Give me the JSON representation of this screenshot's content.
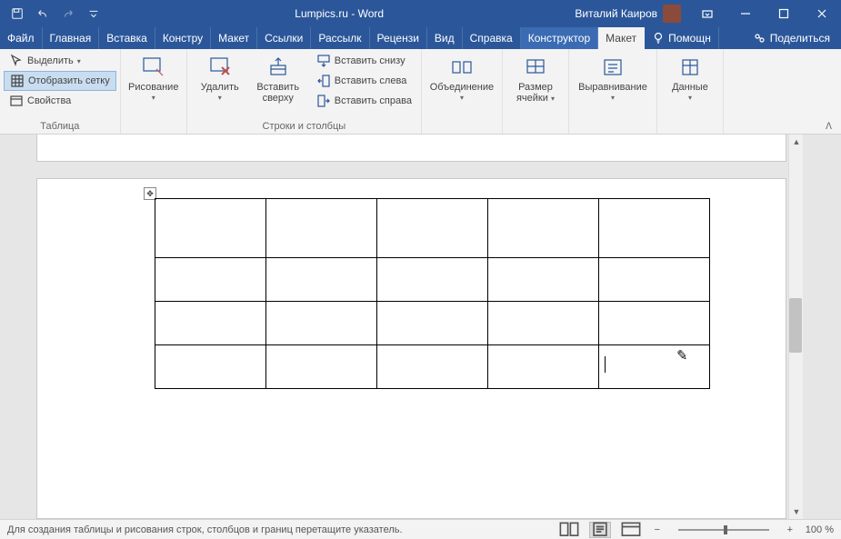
{
  "title": "Lumpics.ru  -  Word",
  "account_name": "Виталий Каиров",
  "tabs": {
    "file": "Файл",
    "home": "Главная",
    "insert": "Вставка",
    "design": "Констру",
    "layout": "Макет",
    "references": "Ссылки",
    "mailings": "Рассылк",
    "review": "Рецензи",
    "view": "Вид",
    "help": "Справка",
    "tbl_design": "Конструктор",
    "tbl_layout": "Макет",
    "tell_me": "Помощн",
    "share": "Поделиться"
  },
  "ribbon": {
    "table_group": "Таблица",
    "select": "Выделить",
    "view_gridlines": "Отобразить сетку",
    "properties": "Свойства",
    "draw": "Рисование",
    "delete": "Удалить",
    "insert_above": "Вставить сверху",
    "insert_below": "Вставить снизу",
    "insert_left": "Вставить слева",
    "insert_right": "Вставить справа",
    "rows_cols_group": "Строки и столбцы",
    "merge": "Объединение",
    "cell_size_l1": "Размер",
    "cell_size_l2": "ячейки",
    "alignment": "Выравнивание",
    "data": "Данные"
  },
  "status": {
    "message": "Для создания таблицы и рисования строк, столбцов и границ перетащите указатель.",
    "zoom": "100 %"
  },
  "table": {
    "rows": 4,
    "cols": 5
  }
}
